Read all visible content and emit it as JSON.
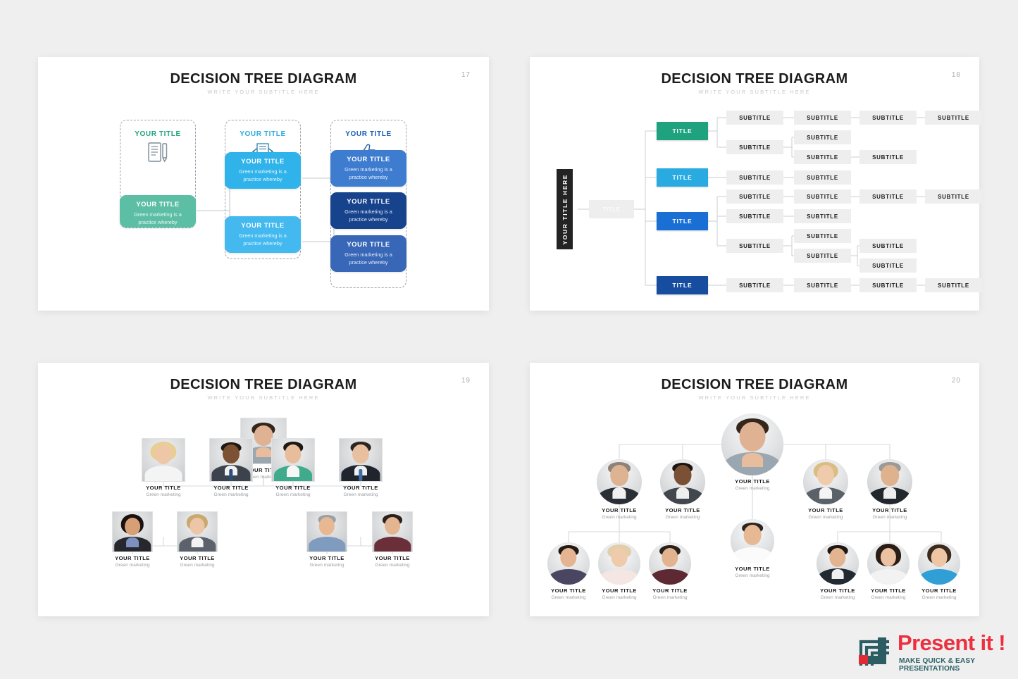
{
  "page": {
    "background": "#efefef"
  },
  "slides": [
    {
      "id": "17",
      "title": "DECISION TREE DIAGRAM",
      "subtitle": "WRITE YOUR SUBTITLE HERE",
      "number": "17",
      "columns": [
        {
          "head": "YOUR TITLE",
          "head_color": "#1fa37f",
          "icon": "document-pencil-icon"
        },
        {
          "head": "YOUR TITLE",
          "head_color": "#29abe2",
          "icon": "open-envelope-icon"
        },
        {
          "head": "YOUR TITLE",
          "head_color": "#1a5fb8",
          "icon": "thumbs-up-icon"
        }
      ],
      "cards": [
        {
          "title": "YOUR TITLE",
          "body": "Green marketing is a practice whereby",
          "color": "#5cbfa5"
        },
        {
          "title": "YOUR TITLE",
          "body": "Green marketing is a practice whereby",
          "color": "#2fb3ea"
        },
        {
          "title": "YOUR TITLE",
          "body": "Green marketing is a practice whereby",
          "color": "#43b9ef"
        },
        {
          "title": "YOUR TITLE",
          "body": "Green marketing is a practice whereby",
          "color": "#3e7cd0"
        },
        {
          "title": "YOUR TITLE",
          "body": "Green marketing is a practice whereby",
          "color": "#17428c"
        },
        {
          "title": "YOUR TITLE",
          "body": "Green marketing is a practice whereby",
          "color": "#3867b8"
        }
      ]
    },
    {
      "id": "18",
      "title": "DECISION TREE DIAGRAM",
      "subtitle": "WRITE YOUR SUBTITLE HERE",
      "number": "18",
      "root_label": "YOUR TITLE HERE",
      "center_label": "TITLE",
      "branches": [
        {
          "label": "TITLE",
          "color": "#1fa37f"
        },
        {
          "label": "TITLE",
          "color": "#29abe2"
        },
        {
          "label": "TITLE",
          "color": "#1a6fd4"
        },
        {
          "label": "TITLE",
          "color": "#164d9e"
        }
      ],
      "subtitle_label": "SUBTITLE",
      "subtitle_count": 26
    },
    {
      "id": "19",
      "title": "DECISION TREE DIAGRAM",
      "subtitle": "WRITE YOUR SUBTITLE HERE",
      "number": "19",
      "people": [
        {
          "name": "YOUR TITLE",
          "role": "Green marketing"
        },
        {
          "name": "YOUR TITLE",
          "role": "Green marketing"
        },
        {
          "name": "YOUR TITLE",
          "role": "Green marketing"
        },
        {
          "name": "YOUR TITLE",
          "role": "Green marketing"
        },
        {
          "name": "YOUR TITLE",
          "role": "Green marketing"
        },
        {
          "name": "YOUR TITLE",
          "role": "Green marketing"
        },
        {
          "name": "YOUR TITLE",
          "role": "Green marketing"
        },
        {
          "name": "YOUR TITLE",
          "role": "Green marketing"
        },
        {
          "name": "YOUR TITLE",
          "role": "Green marketing"
        }
      ]
    },
    {
      "id": "20",
      "title": "DECISION TREE DIAGRAM",
      "subtitle": "WRITE YOUR SUBTITLE HERE",
      "number": "20",
      "people": [
        {
          "name": "YOUR TITLE",
          "role": "Green marketing"
        },
        {
          "name": "YOUR TITLE",
          "role": "Green marketing"
        },
        {
          "name": "YOUR TITLE",
          "role": "Green marketing"
        },
        {
          "name": "YOUR TITLE",
          "role": "Green marketing"
        },
        {
          "name": "YOUR TITLE",
          "role": "Green marketing"
        },
        {
          "name": "YOUR TITLE",
          "role": "Green marketing"
        },
        {
          "name": "YOUR TITLE",
          "role": "Green marketing"
        },
        {
          "name": "YOUR TITLE",
          "role": "Green marketing"
        },
        {
          "name": "YOUR TITLE",
          "role": "Green marketing"
        },
        {
          "name": "YOUR TITLE",
          "role": "Green marketing"
        },
        {
          "name": "YOUR TITLE",
          "role": "Green marketing"
        },
        {
          "name": "YOUR TITLE",
          "role": "Green marketing"
        }
      ]
    }
  ],
  "logo": {
    "name": "Present it !",
    "tagline": "MAKE QUICK & EASY PRESENTATIONS",
    "brand_red": "#ed2f3f",
    "brand_teal": "#2c6168"
  }
}
